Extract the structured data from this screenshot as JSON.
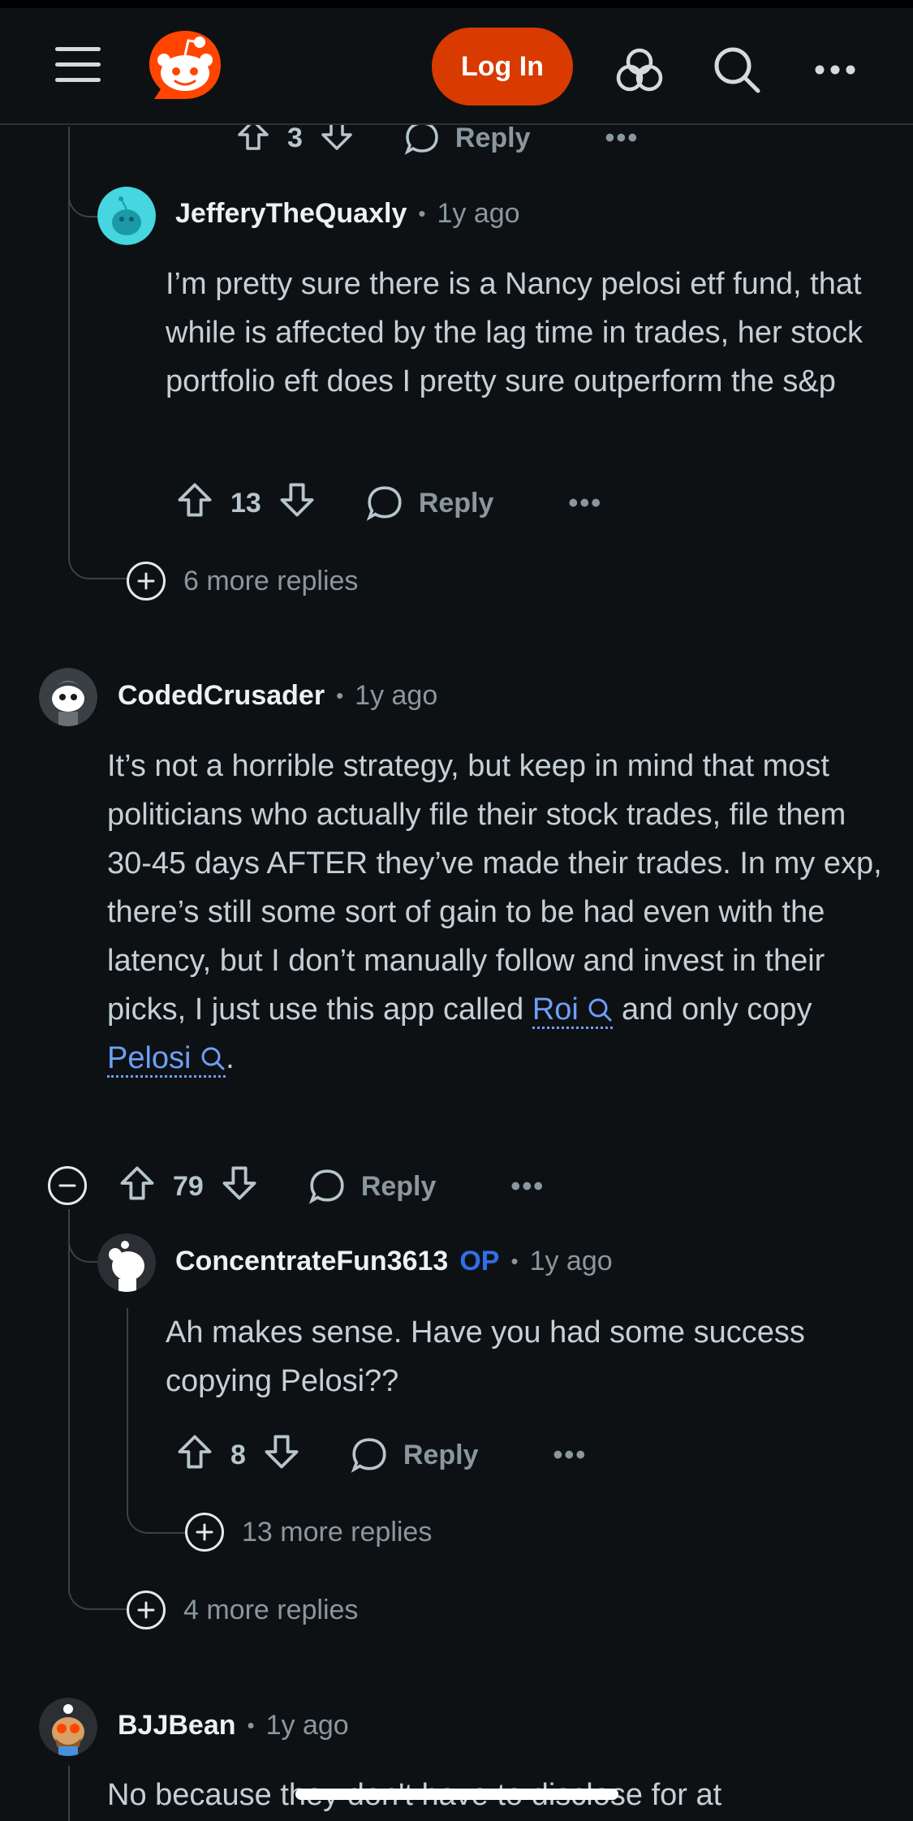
{
  "header": {
    "login_label": "Log In"
  },
  "top_actions": {
    "score": "3",
    "reply_label": "Reply",
    "more_label": "•••"
  },
  "comments": [
    {
      "user": "JefferyTheQuaxly",
      "dot": "•",
      "time": "1y ago",
      "body": "I’m pretty sure there is a Nancy pelosi etf fund, that while is affected by the lag time in trades, her stock portfolio eft does I pretty sure outperform the s&p",
      "score": "13",
      "reply_label": "Reply",
      "more_label": "•••"
    },
    {
      "user": "CodedCrusader",
      "dot": "•",
      "time": "1y ago",
      "body_part1": "It’s not a horrible strategy, but keep in mind that most politicians who actually file their stock trades, file them 30-45 days AFTER they’ve made their trades. In my exp, there’s still some sort of gain to be had even with the latency, but I don’t manually follow and invest in their picks, I just use this app called ",
      "link1": "Roi",
      "body_part2": " and only copy ",
      "link2": "Pelosi",
      "body_part3": ".",
      "score": "79",
      "reply_label": "Reply",
      "more_label": "•••"
    },
    {
      "user": "ConcentrateFun3613",
      "op_badge": "OP",
      "dot": "•",
      "time": "1y ago",
      "body": "Ah makes sense. Have you had some success copying Pelosi??",
      "score": "8",
      "reply_label": "Reply",
      "more_label": "•••"
    },
    {
      "user": "BJJBean",
      "dot": "•",
      "time": "1y ago",
      "body": "No because they don't have to disclose for at"
    }
  ],
  "more_replies": {
    "first": "6 more replies",
    "nested": "13 more replies",
    "second": "4 more replies"
  }
}
